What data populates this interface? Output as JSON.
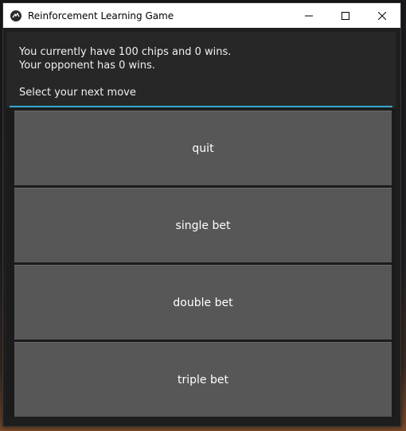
{
  "window": {
    "title": "Reinforcement Learning Game",
    "app_icon": "kivy-logo-icon",
    "controls": [
      "minimize-icon",
      "maximize-icon",
      "close-icon"
    ]
  },
  "status": {
    "line1": "You currently have 100 chips and 0 wins.",
    "line2": "Your opponent has 0 wins.",
    "prompt": "Select your next move"
  },
  "buttons": {
    "quit": "quit",
    "single_bet": "single bet",
    "double_bet": "double bet",
    "triple_bet": "triple bet"
  },
  "colors": {
    "accent": "#33a6cf",
    "button_bg": "#575757",
    "panel_bg": "#272727"
  }
}
